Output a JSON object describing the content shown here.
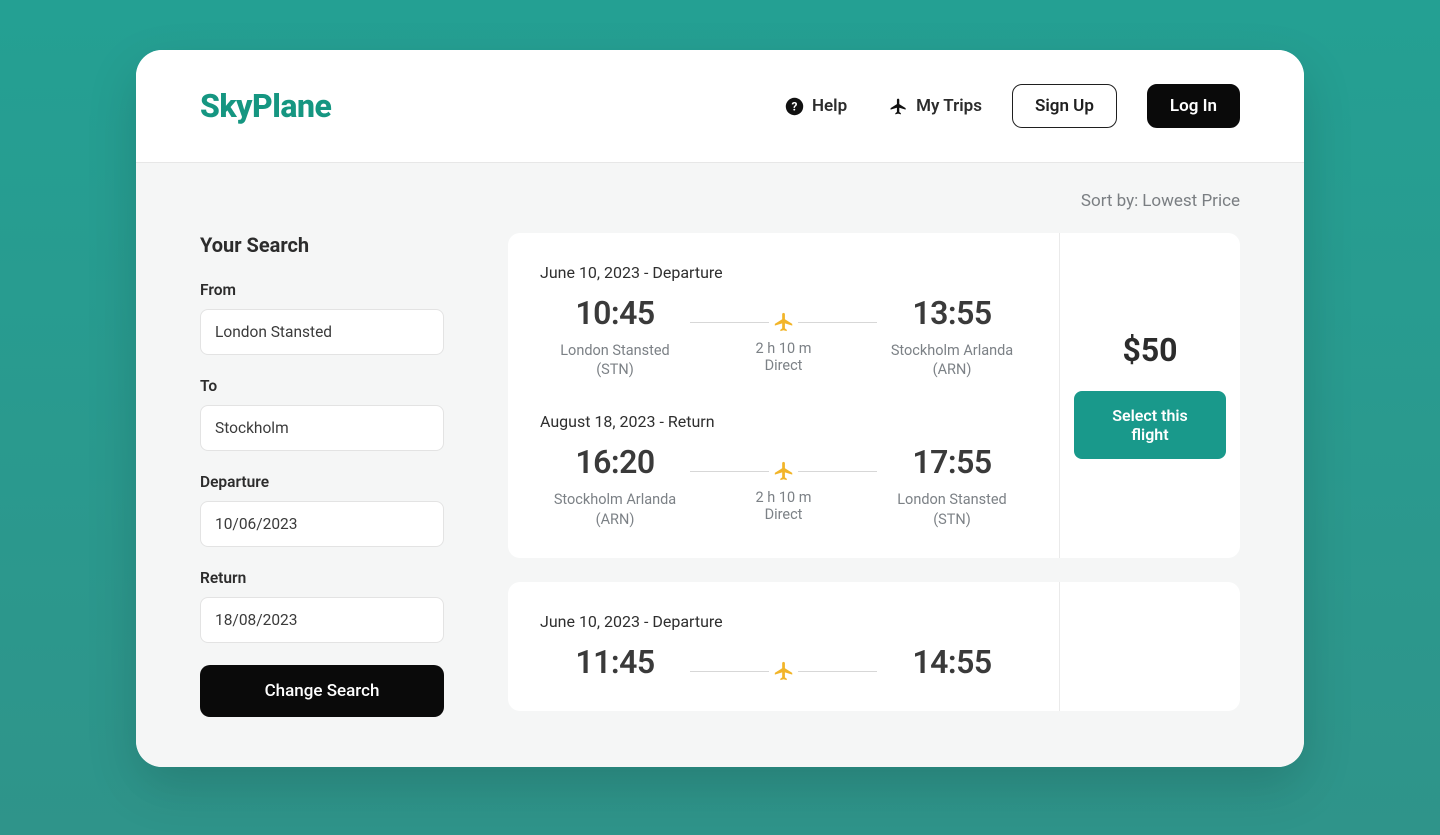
{
  "brand": "SkyPlane",
  "header": {
    "help": "Help",
    "mytrips": "My Trips",
    "signup": "Sign Up",
    "login": "Log In"
  },
  "sort": {
    "label": "Sort by:",
    "value": "Lowest Price"
  },
  "sidebar": {
    "title": "Your Search",
    "from_label": "From",
    "from_value": "London Stansted",
    "to_label": "To",
    "to_value": "Stockholm",
    "dep_label": "Departure",
    "dep_value": "10/06/2023",
    "ret_label": "Return",
    "ret_value": "18/08/2023",
    "change": "Change Search"
  },
  "results": [
    {
      "price": "$50",
      "select": "Select this flight",
      "legs": [
        {
          "label": "June 10, 2023 - Departure",
          "dep_time": "10:45",
          "dep_airport_name": "London Stansted",
          "dep_airport_code": "(STN)",
          "duration": "2 h 10 m",
          "direct": "Direct",
          "arr_time": "13:55",
          "arr_airport_name": "Stockholm Arlanda",
          "arr_airport_code": "(ARN)"
        },
        {
          "label": "August 18, 2023 - Return",
          "dep_time": "16:20",
          "dep_airport_name": "Stockholm Arlanda",
          "dep_airport_code": "(ARN)",
          "duration": "2 h 10 m",
          "direct": "Direct",
          "arr_time": "17:55",
          "arr_airport_name": "London Stansted",
          "arr_airport_code": "(STN)"
        }
      ]
    },
    {
      "legs": [
        {
          "label": "June 10, 2023 - Departure",
          "dep_time": "11:45",
          "arr_time": "14:55"
        }
      ]
    }
  ]
}
